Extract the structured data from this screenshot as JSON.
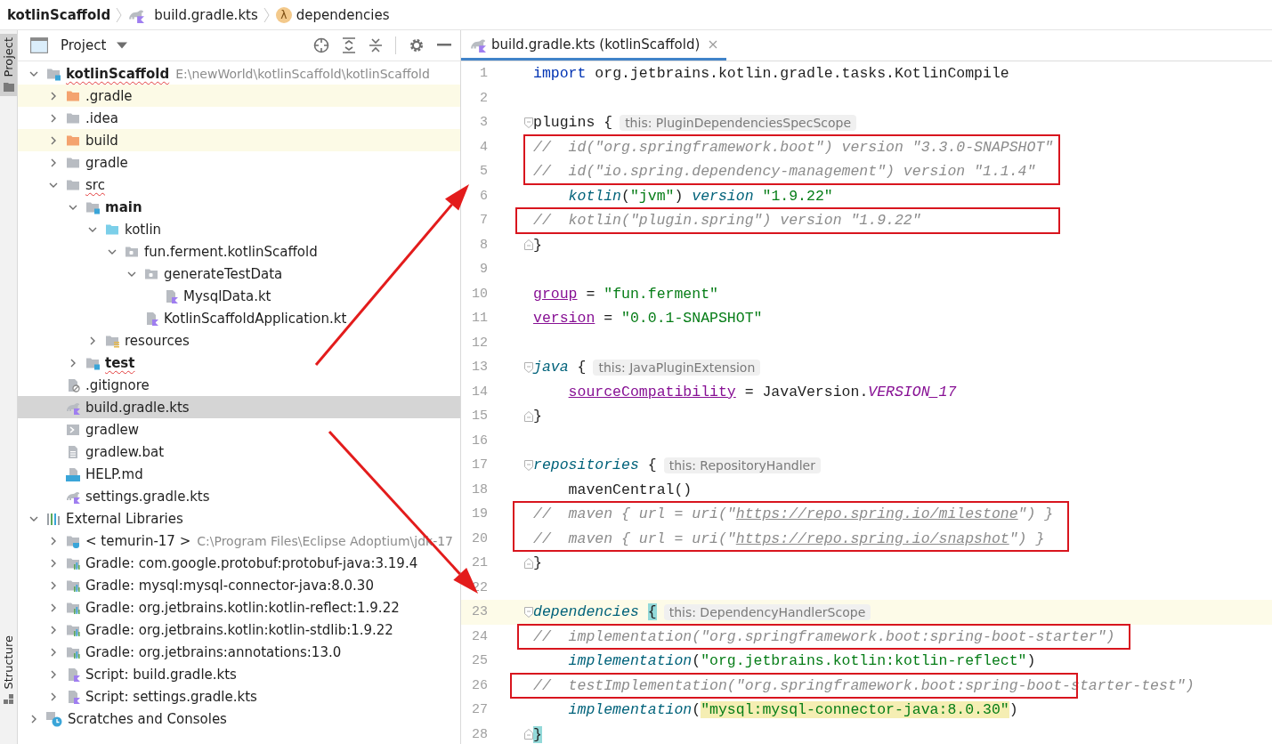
{
  "breadcrumbs": [
    {
      "kind": "project",
      "text": "kotlinScaffold"
    },
    {
      "kind": "file",
      "text": "build.gradle.kts"
    },
    {
      "kind": "function",
      "glyph": "λ",
      "text": "dependencies"
    }
  ],
  "side_tabs": [
    {
      "label": "Project",
      "selected": true
    },
    {
      "label": "Structure",
      "selected": false
    }
  ],
  "project_panel": {
    "title": "Project",
    "tree": [
      {
        "label": "kotlinScaffold",
        "kind": "module",
        "bold": true,
        "squiggle": true,
        "detail": "E:\\newWorld\\kotlinScaffold\\kotlinScaffold",
        "expanded": true,
        "selected": false,
        "highlighted": false,
        "children": [
          {
            "label": ".gradle",
            "kind": "excluded-folder",
            "bold": false,
            "squiggle": false,
            "expanded": false,
            "selected": false,
            "highlighted": true
          },
          {
            "label": ".idea",
            "kind": "folder",
            "bold": false,
            "squiggle": false,
            "expanded": false,
            "selected": false,
            "highlighted": false
          },
          {
            "label": "build",
            "kind": "excluded-folder",
            "bold": false,
            "squiggle": false,
            "expanded": false,
            "selected": false,
            "highlighted": true
          },
          {
            "label": "gradle",
            "kind": "folder",
            "bold": false,
            "squiggle": false,
            "expanded": false,
            "selected": false,
            "highlighted": false
          },
          {
            "label": "src",
            "kind": "folder",
            "bold": false,
            "squiggle": true,
            "expanded": true,
            "selected": false,
            "highlighted": false,
            "children": [
              {
                "label": "main",
                "kind": "module",
                "bold": true,
                "squiggle": false,
                "expanded": true,
                "selected": false,
                "highlighted": false,
                "children": [
                  {
                    "label": "kotlin",
                    "kind": "source",
                    "bold": false,
                    "squiggle": false,
                    "expanded": true,
                    "selected": false,
                    "highlighted": false,
                    "children": [
                      {
                        "label": "fun.ferment.kotlinScaffold",
                        "kind": "package",
                        "bold": false,
                        "squiggle": false,
                        "expanded": true,
                        "selected": false,
                        "highlighted": false,
                        "children": [
                          {
                            "label": "generateTestData",
                            "kind": "package",
                            "bold": false,
                            "squiggle": false,
                            "expanded": true,
                            "selected": false,
                            "highlighted": false,
                            "children": [
                              {
                                "label": "MysqlData.kt",
                                "kind": "kotlin",
                                "bold": false,
                                "squiggle": false,
                                "selected": false,
                                "highlighted": false
                              }
                            ]
                          },
                          {
                            "label": "KotlinScaffoldApplication.kt",
                            "kind": "kotlin",
                            "bold": false,
                            "squiggle": false,
                            "selected": false,
                            "highlighted": false
                          }
                        ]
                      }
                    ]
                  },
                  {
                    "label": "resources",
                    "kind": "resources",
                    "bold": false,
                    "squiggle": false,
                    "expanded": false,
                    "selected": false,
                    "highlighted": false
                  }
                ]
              },
              {
                "label": "test",
                "kind": "module",
                "bold": true,
                "squiggle": true,
                "expanded": false,
                "selected": false,
                "highlighted": false
              }
            ]
          },
          {
            "label": ".gitignore",
            "kind": "ignore",
            "bold": false,
            "squiggle": false,
            "selected": false,
            "highlighted": false
          },
          {
            "label": "build.gradle.kts",
            "kind": "gradle",
            "bold": false,
            "squiggle": false,
            "selected": true,
            "highlighted": false
          },
          {
            "label": "gradlew",
            "kind": "shell",
            "bold": false,
            "squiggle": false,
            "selected": false,
            "highlighted": false
          },
          {
            "label": "gradlew.bat",
            "kind": "text",
            "bold": false,
            "squiggle": false,
            "selected": false,
            "highlighted": false
          },
          {
            "label": "HELP.md",
            "kind": "markdown",
            "bold": false,
            "squiggle": false,
            "selected": false,
            "highlighted": false
          },
          {
            "label": "settings.gradle.kts",
            "kind": "gradle",
            "bold": false,
            "squiggle": false,
            "selected": false,
            "highlighted": false
          }
        ]
      },
      {
        "label": "External Libraries",
        "kind": "libraries",
        "bold": false,
        "squiggle": false,
        "expanded": true,
        "selected": false,
        "highlighted": false,
        "children": [
          {
            "label": "< temurin-17 >",
            "kind": "jdk",
            "bold": false,
            "squiggle": false,
            "detail": "C:\\Program Files\\Eclipse Adoptium\\jdk-17",
            "expanded": false,
            "selected": false,
            "highlighted": false
          },
          {
            "label": "Gradle: com.google.protobuf:protobuf-java:3.19.4",
            "kind": "library",
            "bold": false,
            "squiggle": false,
            "expanded": false,
            "selected": false,
            "highlighted": false
          },
          {
            "label": "Gradle: mysql:mysql-connector-java:8.0.30",
            "kind": "library",
            "bold": false,
            "squiggle": false,
            "expanded": false,
            "selected": false,
            "highlighted": false
          },
          {
            "label": "Gradle: org.jetbrains.kotlin:kotlin-reflect:1.9.22",
            "kind": "library",
            "bold": false,
            "squiggle": false,
            "expanded": false,
            "selected": false,
            "highlighted": false
          },
          {
            "label": "Gradle: org.jetbrains.kotlin:kotlin-stdlib:1.9.22",
            "kind": "library",
            "bold": false,
            "squiggle": false,
            "expanded": false,
            "selected": false,
            "highlighted": false
          },
          {
            "label": "Gradle: org.jetbrains:annotations:13.0",
            "kind": "library",
            "bold": false,
            "squiggle": false,
            "expanded": false,
            "selected": false,
            "highlighted": false
          },
          {
            "label": "Script: build.gradle.kts",
            "kind": "script",
            "bold": false,
            "squiggle": false,
            "expanded": false,
            "selected": false,
            "highlighted": false
          },
          {
            "label": "Script: settings.gradle.kts",
            "kind": "script",
            "bold": false,
            "squiggle": false,
            "expanded": false,
            "selected": false,
            "highlighted": false
          }
        ]
      },
      {
        "label": "Scratches and Consoles",
        "kind": "scratches",
        "bold": false,
        "squiggle": false,
        "expanded": false,
        "selected": false,
        "highlighted": false
      }
    ]
  },
  "editor": {
    "tabs": [
      {
        "label": "build.gradle.kts (kotlinScaffold)",
        "selected": true
      }
    ],
    "lines": [
      {
        "n": "1",
        "kind": "plain",
        "boxed": false,
        "current": false,
        "tokens": [
          {
            "kind": "keyword",
            "text": "import"
          },
          {
            "kind": "plain",
            "text": " org.jetbrains.kotlin.gradle.tasks.KotlinCompile"
          }
        ]
      },
      {
        "n": "2",
        "kind": "plain",
        "boxed": false,
        "current": false
      },
      {
        "n": "3",
        "kind": "fold-open",
        "boxed": false,
        "current": false,
        "tokens": [
          {
            "kind": "plain",
            "text": "plugins {"
          }
        ],
        "hint": "this: PluginDependenciesSpecScope"
      },
      {
        "n": "4",
        "kind": "plain",
        "boxed": true,
        "current": false,
        "tokens": [
          {
            "kind": "comment",
            "text": "//  id(\"org.springframework.boot\") version \"3.3.0-SNAPSHOT\""
          }
        ]
      },
      {
        "n": "5",
        "kind": "plain",
        "boxed": true,
        "current": false,
        "tokens": [
          {
            "kind": "comment",
            "text": "//  id(\"io.spring.dependency-management\") version \"1.1.4\""
          }
        ]
      },
      {
        "n": "6",
        "kind": "plain",
        "boxed": false,
        "current": false,
        "tokens": [
          {
            "kind": "call",
            "text": "    kotlin"
          },
          {
            "kind": "plain",
            "text": "("
          },
          {
            "kind": "string",
            "text": "\"jvm\""
          },
          {
            "kind": "plain",
            "text": ") "
          },
          {
            "kind": "call",
            "text": "version"
          },
          {
            "kind": "string",
            "text": " \"1.9.22\""
          }
        ]
      },
      {
        "n": "7",
        "kind": "plain",
        "boxed": true,
        "current": false,
        "tokens": [
          {
            "kind": "comment",
            "text": "//  kotlin(\"plugin.spring\") version \"1.9.22\""
          }
        ]
      },
      {
        "n": "8",
        "kind": "fold-close",
        "boxed": false,
        "current": false,
        "tokens": [
          {
            "kind": "plain",
            "text": "}"
          }
        ]
      },
      {
        "n": "9",
        "kind": "plain",
        "boxed": false,
        "current": false
      },
      {
        "n": "10",
        "kind": "plain",
        "boxed": false,
        "current": false,
        "tokens": [
          {
            "kind": "property",
            "text": "group"
          },
          {
            "kind": "plain",
            "text": " = "
          },
          {
            "kind": "string",
            "text": "\"fun.ferment\""
          }
        ]
      },
      {
        "n": "11",
        "kind": "plain",
        "boxed": false,
        "current": false,
        "tokens": [
          {
            "kind": "property",
            "text": "version"
          },
          {
            "kind": "plain",
            "text": " = "
          },
          {
            "kind": "string",
            "text": "\"0.0.1-SNAPSHOT\""
          }
        ]
      },
      {
        "n": "12",
        "kind": "plain",
        "boxed": false,
        "current": false
      },
      {
        "n": "13",
        "kind": "fold-open",
        "boxed": false,
        "current": false,
        "tokens": [
          {
            "kind": "call",
            "text": "java"
          },
          {
            "kind": "plain",
            "text": " {"
          }
        ],
        "hint": "this: JavaPluginExtension"
      },
      {
        "n": "14",
        "kind": "plain",
        "boxed": false,
        "current": false,
        "tokens": [
          {
            "kind": "property",
            "text": "    sourceCompatibility"
          },
          {
            "kind": "plain",
            "text": " = JavaVersion."
          },
          {
            "kind": "constant",
            "text": "VERSION_17"
          }
        ]
      },
      {
        "n": "15",
        "kind": "fold-close",
        "boxed": false,
        "current": false,
        "tokens": [
          {
            "kind": "plain",
            "text": "}"
          }
        ]
      },
      {
        "n": "16",
        "kind": "plain",
        "boxed": false,
        "current": false
      },
      {
        "n": "17",
        "kind": "fold-open",
        "boxed": false,
        "current": false,
        "tokens": [
          {
            "kind": "call",
            "text": "repositories"
          },
          {
            "kind": "plain",
            "text": " {"
          }
        ],
        "hint": "this: RepositoryHandler"
      },
      {
        "n": "18",
        "kind": "plain",
        "boxed": false,
        "current": false,
        "tokens": [
          {
            "kind": "plain",
            "text": "    mavenCentral()"
          }
        ]
      },
      {
        "n": "19",
        "kind": "plain",
        "boxed": true,
        "current": false,
        "tokens": [
          {
            "kind": "comment",
            "text": "//  maven { url = uri(\""
          },
          {
            "kind": "comment-link",
            "text": "https://repo.spring.io/milestone"
          },
          {
            "kind": "comment",
            "text": "\") }"
          }
        ]
      },
      {
        "n": "20",
        "kind": "plain",
        "boxed": true,
        "current": false,
        "tokens": [
          {
            "kind": "comment",
            "text": "//  maven { url = uri(\""
          },
          {
            "kind": "comment-link",
            "text": "https://repo.spring.io/snapshot"
          },
          {
            "kind": "comment",
            "text": "\") }"
          }
        ]
      },
      {
        "n": "21",
        "kind": "fold-close",
        "boxed": false,
        "current": false,
        "tokens": [
          {
            "kind": "plain",
            "text": "}"
          }
        ]
      },
      {
        "n": "22",
        "kind": "plain",
        "boxed": false,
        "current": false
      },
      {
        "n": "23",
        "kind": "fold-open",
        "boxed": false,
        "current": true,
        "tokens": [
          {
            "kind": "call",
            "text": "dependencies "
          },
          {
            "kind": "brace-match",
            "text": "{"
          }
        ],
        "hint": "this: DependencyHandlerScope"
      },
      {
        "n": "24",
        "kind": "plain",
        "boxed": true,
        "current": false,
        "tokens": [
          {
            "kind": "comment",
            "text": "//  implementation(\"org.springframework.boot:spring-boot-starter\")"
          }
        ]
      },
      {
        "n": "25",
        "kind": "plain",
        "boxed": false,
        "current": false,
        "tokens": [
          {
            "kind": "call",
            "text": "    implementation"
          },
          {
            "kind": "plain",
            "text": "("
          },
          {
            "kind": "string",
            "text": "\"org.jetbrains.kotlin:kotlin-reflect\""
          },
          {
            "kind": "plain",
            "text": ")"
          }
        ]
      },
      {
        "n": "26",
        "kind": "plain",
        "boxed": true,
        "current": false,
        "tokens": [
          {
            "kind": "comment",
            "text": "//  testImplementation(\"org.springframework.boot:spring-boot-starter-test\")"
          }
        ]
      },
      {
        "n": "27",
        "kind": "plain",
        "boxed": false,
        "current": false,
        "tokens": [
          {
            "kind": "call",
            "text": "    implementation"
          },
          {
            "kind": "plain",
            "text": "("
          },
          {
            "kind": "string-highlight",
            "text": "\"mysql:mysql-connector-java:8.0.30\""
          },
          {
            "kind": "plain",
            "text": ")"
          }
        ]
      },
      {
        "n": "28",
        "kind": "fold-close",
        "boxed": false,
        "current": false,
        "tokens": [
          {
            "kind": "brace-match",
            "text": "}"
          }
        ]
      }
    ]
  }
}
